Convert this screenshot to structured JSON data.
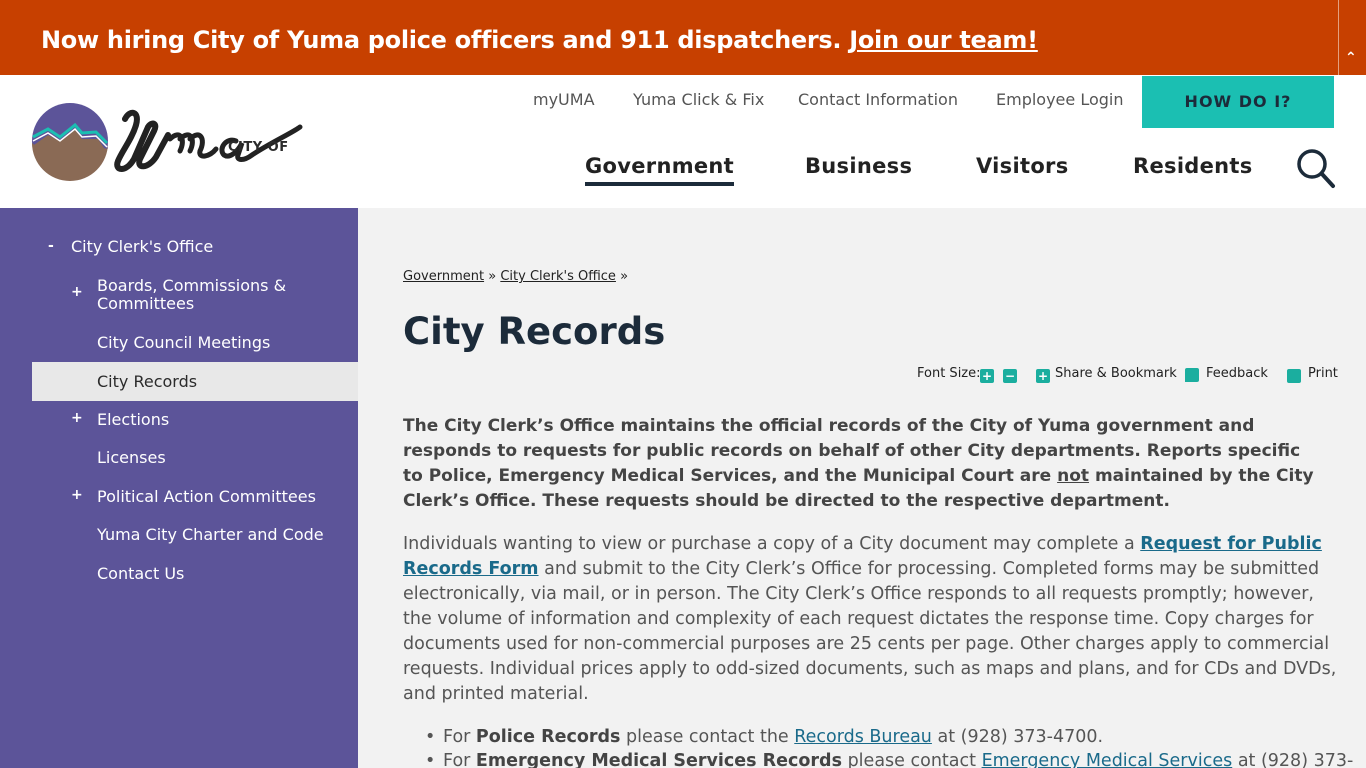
{
  "banner": {
    "text": "Now hiring City of Yuma police officers and 911 dispatchers.",
    "link": "Join our team!",
    "toggle_icon": "double-chevron-up-icon"
  },
  "header": {
    "logo": {
      "small": "CITY OF",
      "name": "Yuma"
    },
    "utility_links": [
      "myUMA",
      "Yuma Click & Fix",
      "Contact Information",
      "Employee Login"
    ],
    "how_do_i": "HOW DO I?",
    "nav": [
      "Government",
      "Business",
      "Visitors",
      "Residents"
    ],
    "nav_active": "Government",
    "search_icon": "search-icon"
  },
  "sidebar": {
    "items": [
      {
        "toggle": "-",
        "label": "City Clerk's Office"
      },
      {
        "toggle": "+",
        "label": "Boards, Commissions & Committees"
      },
      {
        "toggle": "",
        "label": "City Council Meetings"
      },
      {
        "toggle": "",
        "label": "City Records"
      },
      {
        "toggle": "+",
        "label": "Elections"
      },
      {
        "toggle": "",
        "label": "Licenses"
      },
      {
        "toggle": "+",
        "label": "Political Action Committees"
      },
      {
        "toggle": "",
        "label": "Yuma City Charter and Code"
      },
      {
        "toggle": "",
        "label": "Contact Us"
      }
    ]
  },
  "main": {
    "breadcrumb": [
      "Government",
      "City Clerk's Office"
    ],
    "breadcrumb_sep": "»",
    "title": "City Records",
    "tools": {
      "font_size_label": "Font Size:",
      "increase": "+",
      "decrease": "−",
      "share": "Share & Bookmark",
      "feedback": "Feedback",
      "print": "Print"
    },
    "intro_a": "The City Clerk’s Office maintains the official records of the City of Yuma government and responds to requests for public records on behalf of other City departments. Reports specific to Police, Emergency Medical Services, and the Municipal Court are",
    "intro_not": "not",
    "intro_b": "maintained by the City Clerk’s Office. These requests should be directed to the respective department.",
    "para_a": "Individuals wanting to view or purchase a copy of a City document may complete a",
    "para_link": "Request for Public Records Form",
    "para_b": "and submit to the City Clerk’s Office for processing. Completed forms may be submitted electronically, via mail, or in person. The City Clerk’s Office responds to all requests promptly; however, the volume of information and complexity of each request dictates the response time. Copy charges for documents used for non-commercial purposes are 25 cents per page. Other charges apply to commercial requests. Individual prices apply to odd-sized documents, such as maps and plans, and for CDs and DVDs, and printed material.",
    "bullet1": {
      "pre": "For",
      "bold": "Police Records",
      "mid": "please contact the",
      "link": "Records Bureau",
      "post": "at (928) 373-4700."
    },
    "bullet2": {
      "pre": "For",
      "bold": "Emergency Medical Services Records",
      "mid": "please contact",
      "link": "Emergency Medical Services",
      "post": "at (928) 373-"
    }
  },
  "colors": {
    "banner": "#c74000",
    "accent_teal": "#1bbfb2",
    "sidebar": "#5c5499",
    "content_bg": "#f2f2f2",
    "link": "#1a6a8a"
  }
}
